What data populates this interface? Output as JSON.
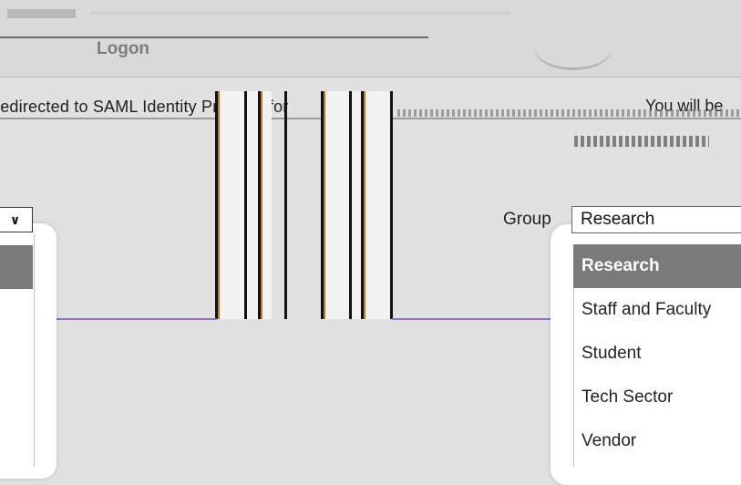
{
  "header": {
    "title": "Logon"
  },
  "message": {
    "redirect_left": "redirected to SAML Identity Provider for",
    "redirect_right": "You will be"
  },
  "left_dropdown": {
    "icon": "chevron-down-icon"
  },
  "group_selector": {
    "label": "Group",
    "selected_value": "Research",
    "options": [
      "Research",
      "Staff and Faculty",
      "Student",
      "Tech Sector",
      "Vendor"
    ],
    "highlighted_index": 0
  },
  "colors": {
    "background": "#e1e1e1",
    "selected_option": "#7a7a7a",
    "connector_line": "#9b6fc0"
  }
}
